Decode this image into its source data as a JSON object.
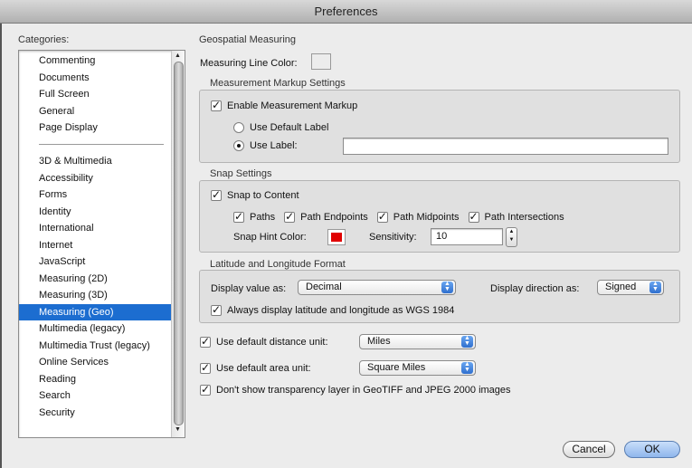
{
  "window": {
    "title": "Preferences"
  },
  "categories": {
    "label": "Categories:",
    "group1": [
      "Commenting",
      "Documents",
      "Full Screen",
      "General",
      "Page Display"
    ],
    "group2": [
      "3D & Multimedia",
      "Accessibility",
      "Forms",
      "Identity",
      "International",
      "Internet",
      "JavaScript",
      "Measuring (2D)",
      "Measuring (3D)",
      "Measuring (Geo)",
      "Multimedia (legacy)",
      "Multimedia Trust (legacy)",
      "Online Services",
      "Reading",
      "Search",
      "Security"
    ],
    "selected": "Measuring (Geo)"
  },
  "panel": {
    "title": "Geospatial Measuring",
    "line_color_label": "Measuring Line Color:",
    "line_color": "#ececec",
    "markup": {
      "header": "Measurement Markup Settings",
      "enable_label": "Enable Measurement Markup",
      "enable_checked": true,
      "default_label": "Use Default Label",
      "use_label": "Use Label:",
      "selected_option": "use_label",
      "label_value": ""
    },
    "snap": {
      "header": "Snap Settings",
      "snap_label": "Snap to Content",
      "paths": "Paths",
      "endpoints": "Path Endpoints",
      "midpoints": "Path Midpoints",
      "intersections": "Path Intersections",
      "hint_color_label": "Snap Hint Color:",
      "hint_color": "#e00000",
      "sensitivity_label": "Sensitivity:",
      "sensitivity": "10"
    },
    "latlong": {
      "header": "Latitude and Longitude Format",
      "display_value_label": "Display value as:",
      "display_value": "Decimal",
      "direction_label": "Display direction as:",
      "direction": "Signed",
      "wgs_label": "Always display latitude and longitude as WGS 1984"
    },
    "distance": {
      "label": "Use default distance unit:",
      "value": "Miles"
    },
    "area": {
      "label": "Use default area unit:",
      "value": "Square Miles"
    },
    "transparency_label": "Don't show transparency layer in GeoTIFF and JPEG 2000 images"
  },
  "buttons": {
    "cancel": "Cancel",
    "ok": "OK"
  }
}
